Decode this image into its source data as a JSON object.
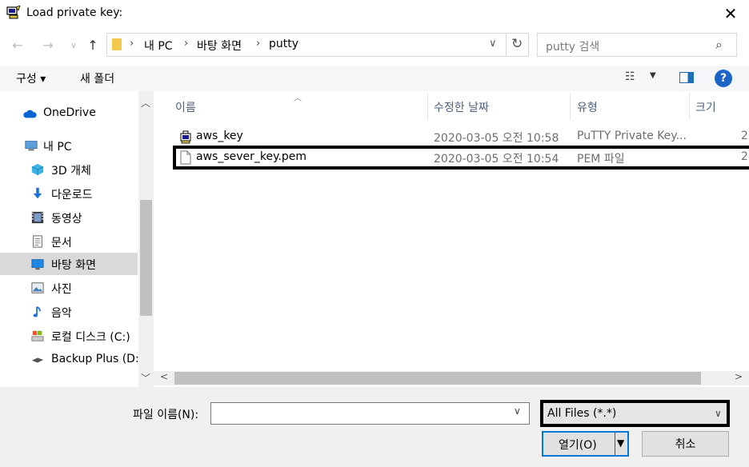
{
  "window": {
    "title": "Load private key:"
  },
  "address": {
    "crumbs": [
      "내 PC",
      "바탕 화면",
      "putty"
    ]
  },
  "search": {
    "placeholder": "putty 검색"
  },
  "toolbar": {
    "organize": "구성 ▾",
    "new_folder": "새 폴더"
  },
  "nav": {
    "items": [
      {
        "label": "OneDrive",
        "icon": "cloud-icon"
      },
      {
        "label": "내 PC",
        "icon": "pc-icon"
      },
      {
        "label": "3D 개체",
        "icon": "cube-icon"
      },
      {
        "label": "다운로드",
        "icon": "download-icon"
      },
      {
        "label": "동영상",
        "icon": "video-icon"
      },
      {
        "label": "문서",
        "icon": "document-icon"
      },
      {
        "label": "바탕 화면",
        "icon": "desktop-icon",
        "selected": true
      },
      {
        "label": "사진",
        "icon": "picture-icon"
      },
      {
        "label": "음악",
        "icon": "music-icon"
      },
      {
        "label": "로컬 디스크 (C:)",
        "icon": "drive-icon"
      },
      {
        "label": "Backup Plus (D:)",
        "icon": "usb-drive-icon"
      }
    ]
  },
  "columns": {
    "name": "이름",
    "date": "수정한 날짜",
    "type": "유형",
    "size": "크기"
  },
  "files": [
    {
      "name": "aws_key",
      "date": "2020-03-05 오전 10:58",
      "type": "PuTTY Private Key...",
      "size": "2",
      "icon": "putty-key-icon"
    },
    {
      "name": "aws_sever_key.pem",
      "date": "2020-03-05 오전 10:54",
      "type": "PEM 파일",
      "size": "2",
      "icon": "file-icon"
    }
  ],
  "bottom": {
    "filename_label": "파일 이름(N):",
    "filename_value": "",
    "filter": "All Files (*.*)",
    "open": "열기(O)",
    "cancel": "취소"
  }
}
